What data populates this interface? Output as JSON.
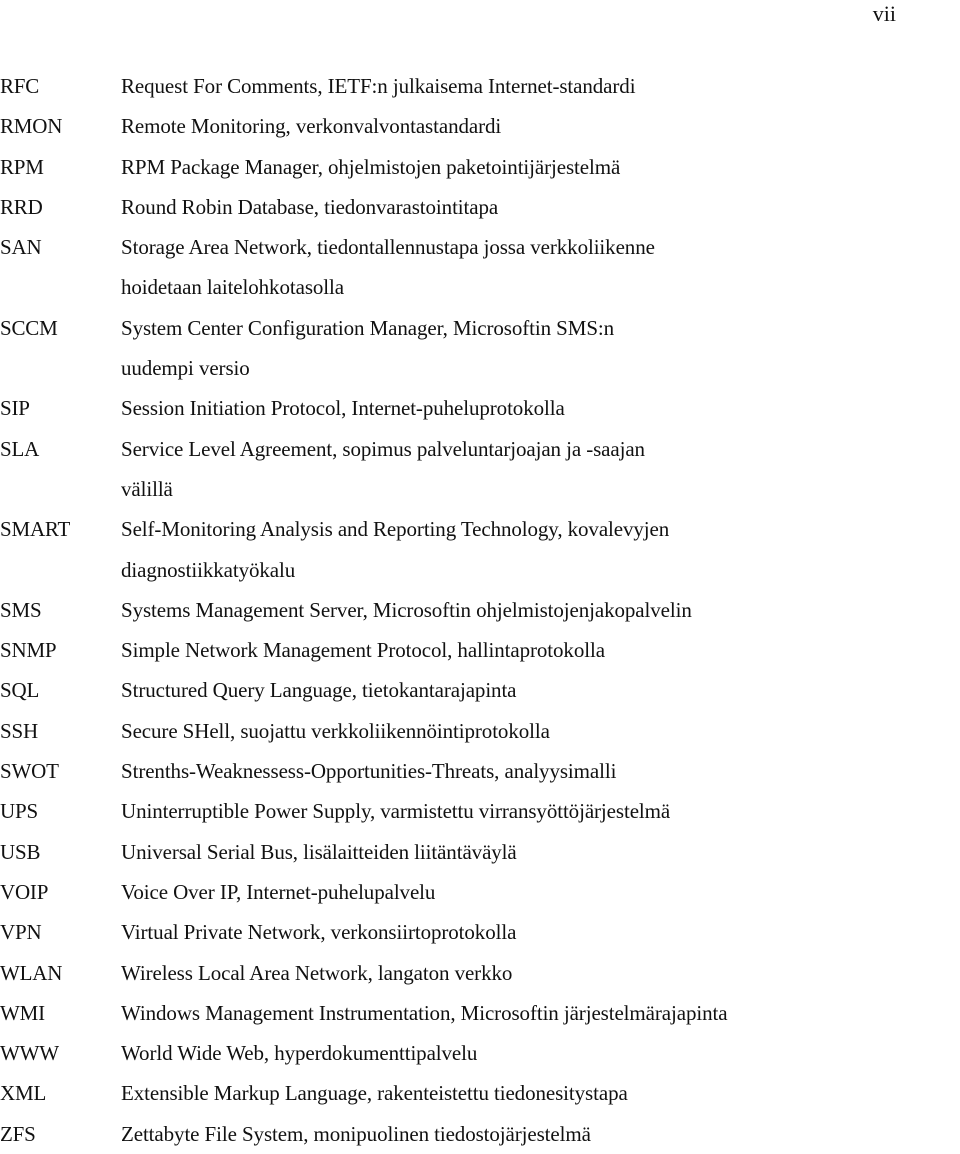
{
  "page": {
    "number": "vii"
  },
  "glossary": [
    {
      "abbr": "RFC",
      "lines": [
        "Request For Comments, IETF:n julkaisema Internet-standardi"
      ]
    },
    {
      "abbr": "RMON",
      "lines": [
        "Remote Monitoring, verkonvalvontastandardi"
      ]
    },
    {
      "abbr": "RPM",
      "lines": [
        "RPM Package Manager, ohjelmistojen paketointijärjestelmä"
      ]
    },
    {
      "abbr": "RRD",
      "lines": [
        "Round Robin Database, tiedonvarastointitapa"
      ]
    },
    {
      "abbr": "SAN",
      "lines": [
        "Storage Area Network, tiedontallennustapa jossa verkkoliikenne",
        "hoidetaan laitelohkotasolla"
      ]
    },
    {
      "abbr": "SCCM",
      "lines": [
        "System Center Configuration Manager, Microsoftin SMS:n",
        "uudempi versio"
      ]
    },
    {
      "abbr": "SIP",
      "lines": [
        "Session Initiation Protocol, Internet-puheluprotokolla"
      ]
    },
    {
      "abbr": "SLA",
      "lines": [
        "Service Level Agreement, sopimus palveluntarjoajan ja -saajan",
        "välillä"
      ]
    },
    {
      "abbr": "SMART",
      "lines": [
        "Self-Monitoring Analysis and Reporting Technology, kovalevyjen",
        "diagnostiikkatyökalu"
      ]
    },
    {
      "abbr": "SMS",
      "lines": [
        "Systems Management Server, Microsoftin ohjelmistojenjakopalvelin"
      ]
    },
    {
      "abbr": "SNMP",
      "lines": [
        "Simple Network Management Protocol, hallintaprotokolla"
      ]
    },
    {
      "abbr": "SQL",
      "lines": [
        "Structured Query Language, tietokantarajapinta"
      ]
    },
    {
      "abbr": "SSH",
      "lines": [
        "Secure SHell, suojattu verkkoliikennöintiprotokolla"
      ]
    },
    {
      "abbr": "SWOT",
      "lines": [
        "Strenths-Weaknessess-Opportunities-Threats, analyysimalli"
      ]
    },
    {
      "abbr": "UPS",
      "lines": [
        "Uninterruptible Power Supply, varmistettu virransyöttöjärjestelmä"
      ]
    },
    {
      "abbr": "USB",
      "lines": [
        "Universal Serial Bus, lisälaitteiden liitäntäväylä"
      ]
    },
    {
      "abbr": "VOIP",
      "lines": [
        "Voice Over IP, Internet-puhelupalvelu"
      ]
    },
    {
      "abbr": "VPN",
      "lines": [
        "Virtual Private Network, verkonsiirtoprotokolla"
      ]
    },
    {
      "abbr": "WLAN",
      "lines": [
        "Wireless Local Area Network, langaton verkko"
      ]
    },
    {
      "abbr": "WMI",
      "lines": [
        "Windows Management Instrumentation, Microsoftin järjestelmärajapinta"
      ]
    },
    {
      "abbr": "WWW",
      "lines": [
        "World Wide Web, hyperdokumenttipalvelu"
      ]
    },
    {
      "abbr": "XML",
      "lines": [
        "Extensible Markup Language, rakenteistettu tiedonesitystapa"
      ]
    },
    {
      "abbr": "ZFS",
      "lines": [
        "Zettabyte File System, monipuolinen tiedostojärjestelmä"
      ]
    }
  ]
}
